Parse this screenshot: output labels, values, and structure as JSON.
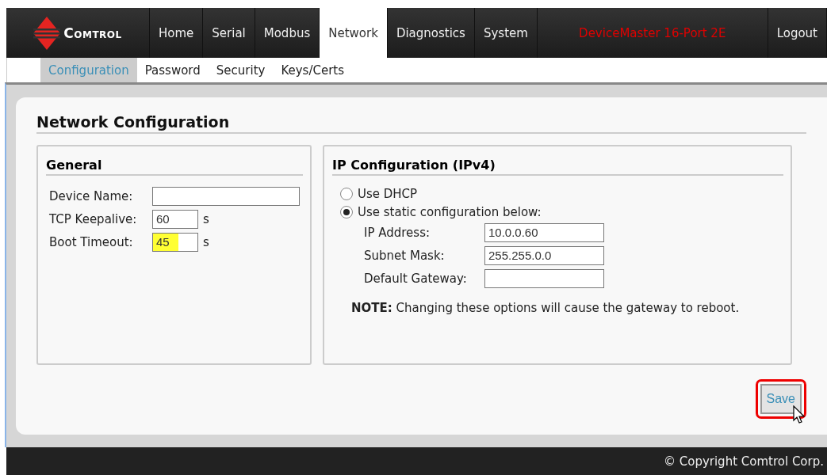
{
  "brand": "Comtrol",
  "nav": [
    {
      "label": "Home",
      "kind": "link",
      "selected": false
    },
    {
      "label": "Serial",
      "kind": "link",
      "selected": false
    },
    {
      "label": "Modbus",
      "kind": "link",
      "selected": false
    },
    {
      "label": "Network",
      "kind": "link",
      "selected": true
    },
    {
      "label": "Diagnostics",
      "kind": "link",
      "selected": false
    },
    {
      "label": "System",
      "kind": "link",
      "selected": false
    },
    {
      "label": "DeviceMaster 16-Port 2E",
      "kind": "device",
      "selected": false
    },
    {
      "label": "Logout",
      "kind": "link",
      "selected": false
    }
  ],
  "subnav": [
    {
      "label": "Configuration",
      "selected": true
    },
    {
      "label": "Password",
      "selected": false
    },
    {
      "label": "Security",
      "selected": false
    },
    {
      "label": "Keys/Certs",
      "selected": false
    }
  ],
  "title": "Network Configuration",
  "general": {
    "title": "General",
    "fields": [
      {
        "label": "Device Name:",
        "kind": "wide",
        "highlighted": false
      },
      {
        "label": "TCP Keepalive:",
        "value": "60",
        "unit": "s",
        "kind": "short",
        "highlighted": false
      },
      {
        "label": "Boot Timeout:",
        "value": "45",
        "unit": "s",
        "kind": "short",
        "highlighted": true
      }
    ]
  },
  "ip": {
    "title": "IP Configuration (IPv4)",
    "modes": [
      {
        "label": "Use DHCP",
        "selected": false
      },
      {
        "label": "Use static configuration below:",
        "selected": true
      }
    ],
    "fields": [
      {
        "label": "IP Address:",
        "value": "10.0.0.60"
      },
      {
        "label": "Subnet Mask:",
        "value": "255.255.0.0"
      },
      {
        "label": "Default Gateway:"
      }
    ],
    "note": "**NOTE:** Changing these options will cause the gateway to reboot."
  },
  "save": {
    "label": "Save",
    "highlighted": true
  },
  "footer": "© Copyright Comtrol Corp."
}
